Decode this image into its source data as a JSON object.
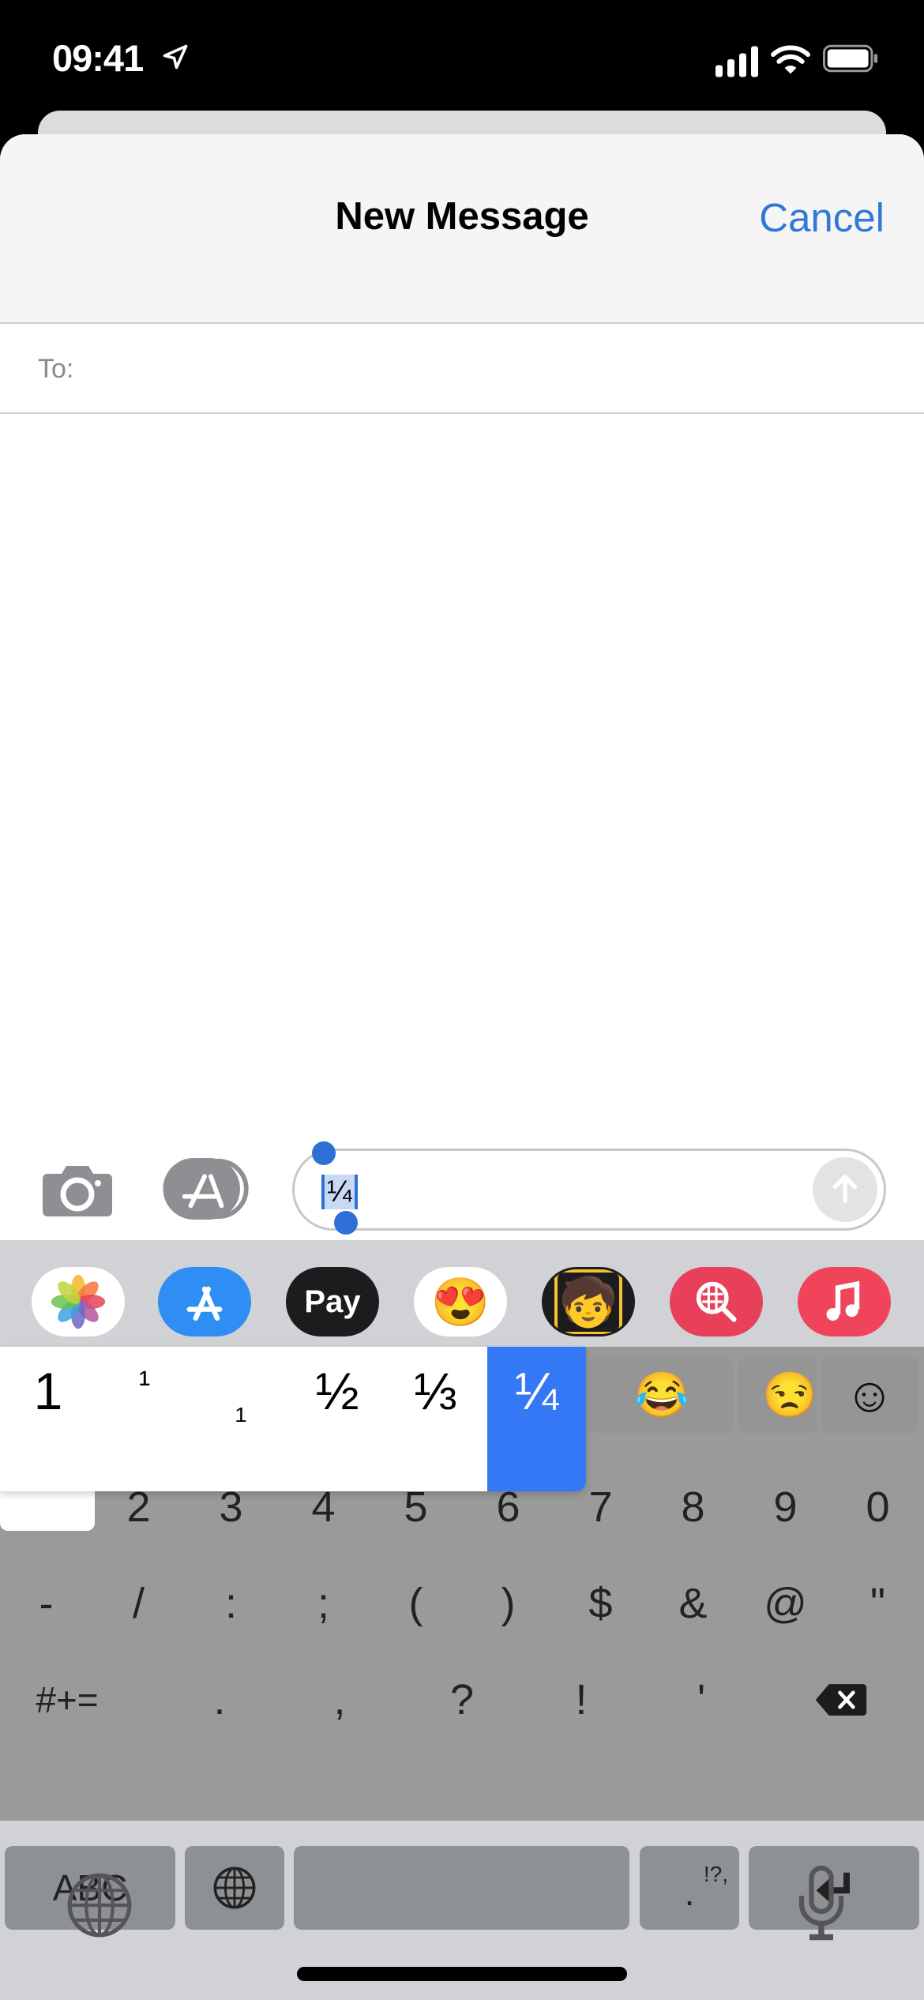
{
  "status_bar": {
    "time": "09:41",
    "location_icon": "location-arrow-icon",
    "signal_icon": "cellular-signal-icon",
    "wifi_icon": "wifi-icon",
    "battery_icon": "battery-icon"
  },
  "header": {
    "title": "New Message",
    "cancel_label": "Cancel"
  },
  "recipient": {
    "label": "To:",
    "value": ""
  },
  "compose": {
    "text": "¼",
    "camera_icon": "camera-icon",
    "apps_icon": "app-store-icon",
    "send_icon": "arrow-up-icon"
  },
  "app_strip": [
    {
      "name": "photos",
      "label": "Photos",
      "bg": "#ffffff"
    },
    {
      "name": "app-store",
      "label": "App Store",
      "bg": "#2f8ef4"
    },
    {
      "name": "apple-pay",
      "label": "Pay",
      "bg": "#1c1c1e"
    },
    {
      "name": "memoji-stickers",
      "label": "Memoji Stickers",
      "bg": "#ffffff"
    },
    {
      "name": "memoji",
      "label": "Memoji",
      "bg": "#1c1c1e"
    },
    {
      "name": "web-images",
      "label": "#images",
      "bg": "#e8405a"
    },
    {
      "name": "music",
      "label": "Music",
      "bg": "#f0445a"
    }
  ],
  "emoji_suggestions": [
    "😂",
    "😒",
    "☺"
  ],
  "popup_options": [
    {
      "char": "1",
      "style": "normal"
    },
    {
      "char": "¹",
      "style": "superscript"
    },
    {
      "char": "₁",
      "style": "subscript"
    },
    {
      "char": "½",
      "style": "normal"
    },
    {
      "char": "⅓",
      "style": "normal"
    },
    {
      "char": "¼",
      "style": "selected"
    }
  ],
  "number_row": [
    "1",
    "2",
    "3",
    "4",
    "5",
    "6",
    "7",
    "8",
    "9",
    "0"
  ],
  "symbol_row": [
    "-",
    "/",
    ":",
    ";",
    "(",
    ")",
    "$",
    "&",
    "@",
    "\""
  ],
  "punct_row": {
    "shift_label": "#+=",
    "keys": [
      ".",
      ",",
      "?",
      "!",
      "'"
    ],
    "delete_icon": "delete-backspace-icon"
  },
  "bottom_row": {
    "abc_label": "ABC",
    "globe_icon": "globe-icon",
    "space_label": "",
    "period_label": ".",
    "period_alt": "!?,",
    "return_icon": "return-icon"
  },
  "system_row": {
    "globe_icon": "globe-icon",
    "mic_icon": "microphone-icon"
  }
}
